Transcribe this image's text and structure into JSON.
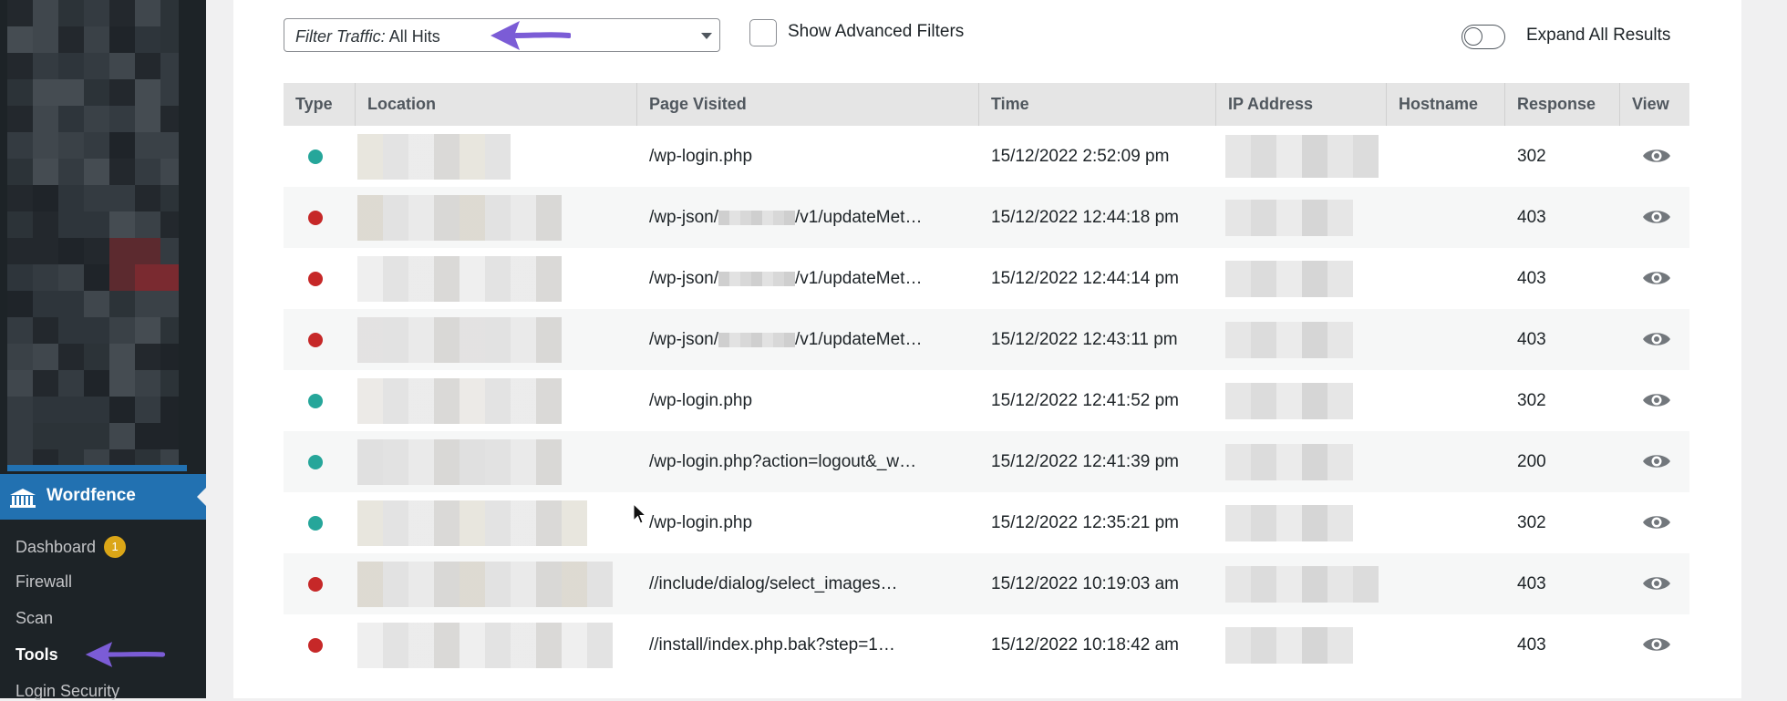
{
  "sidebar": {
    "plugin_label": "Wordfence",
    "menu": [
      {
        "label": "Dashboard",
        "badge": "1",
        "current": false
      },
      {
        "label": "Firewall",
        "current": false
      },
      {
        "label": "Scan",
        "current": false
      },
      {
        "label": "Tools",
        "current": true
      },
      {
        "label": "Login Security",
        "current": false
      }
    ]
  },
  "filters": {
    "filter_prefix": "Filter Traffic:",
    "filter_value": "All Hits",
    "advanced_label": "Show Advanced Filters",
    "advanced_checked": false,
    "expand_label": "Expand All Results",
    "expand_on": false
  },
  "table": {
    "columns": [
      "Type",
      "Location",
      "Page Visited",
      "Time",
      "IP Address",
      "Hostname",
      "Response",
      "View"
    ],
    "rows": [
      {
        "type": "human",
        "page": "/wp-login.php",
        "time": "15/12/2022 2:52:09 pm",
        "response": "302"
      },
      {
        "type": "blocked",
        "page_parts": [
          "/wp-json/",
          "/v1/updateMet…"
        ],
        "time": "15/12/2022 12:44:18 pm",
        "response": "403"
      },
      {
        "type": "blocked",
        "page_parts": [
          "/wp-json/",
          "/v1/updateMet…"
        ],
        "time": "15/12/2022 12:44:14 pm",
        "response": "403"
      },
      {
        "type": "blocked",
        "page_parts": [
          "/wp-json/",
          "/v1/updateMet…"
        ],
        "time": "15/12/2022 12:43:11 pm",
        "response": "403"
      },
      {
        "type": "human",
        "page": "/wp-login.php",
        "time": "15/12/2022 12:41:52 pm",
        "response": "302"
      },
      {
        "type": "human",
        "page": "/wp-login.php?action=logout&_w…",
        "time": "15/12/2022 12:41:39 pm",
        "response": "200"
      },
      {
        "type": "human",
        "page": "/wp-login.php",
        "time": "15/12/2022 12:35:21 pm",
        "response": "302"
      },
      {
        "type": "blocked",
        "page": "//include/dialog/select_images…",
        "time": "15/12/2022 10:19:03 am",
        "response": "403"
      },
      {
        "type": "blocked",
        "page": "//install/index.php.bak?step=1…",
        "time": "15/12/2022 10:18:42 am",
        "response": "403"
      }
    ]
  },
  "colors": {
    "accent": "#2271b1",
    "sidebar_bg": "#1d2327",
    "dot_ok": "#26a69a",
    "dot_blocked": "#c62828",
    "badge": "#dba617",
    "annotation_arrow": "#7b5cd6"
  },
  "icons": [
    "wordfence-logo-icon",
    "chevron-down-icon",
    "eye-icon",
    "mouse-cursor-icon",
    "annotation-arrow-icon"
  ]
}
